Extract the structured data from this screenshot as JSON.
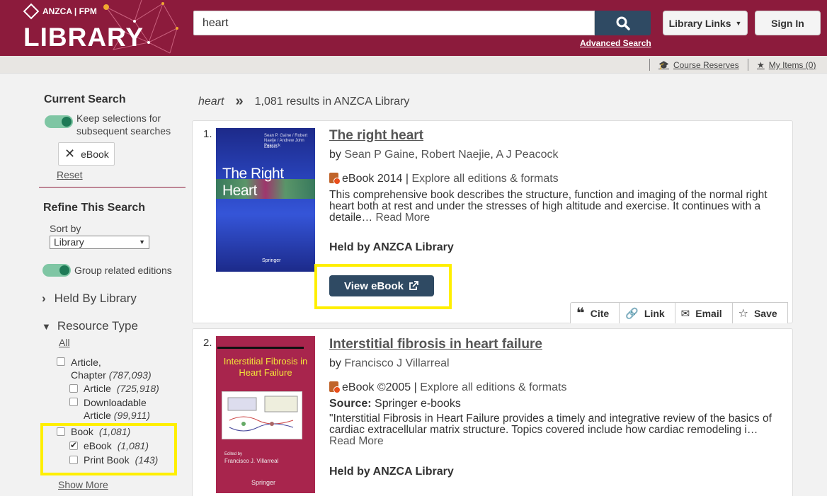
{
  "header": {
    "logo_org": "ANZCA | FPM",
    "logo_title": "LIBRARY",
    "search_value": "heart",
    "advanced_search": "Advanced Search",
    "library_links": "Library Links",
    "sign_in": "Sign In"
  },
  "subbar": {
    "course_reserves": "Course Reserves",
    "my_items": "My Items (0)"
  },
  "sidebar": {
    "current_search": "Current Search",
    "keep_selections": "Keep selections for subsequent searches",
    "chip_label": "eBook",
    "reset": "Reset",
    "refine": "Refine This Search",
    "sort_by_label": "Sort by",
    "sort_value": "Library",
    "group_editions": "Group related editions",
    "held_by": "Held By Library",
    "resource_type": "Resource Type",
    "all": "All",
    "facets": [
      {
        "label1": "Article,",
        "label2": "Chapter",
        "count": "(787,093)",
        "checked": false
      },
      {
        "label": "Article",
        "count": "(725,918)",
        "checked": false
      },
      {
        "label1": "Downloadable",
        "label2": "Article",
        "count": "(99,911)",
        "checked": false
      },
      {
        "label": "Book",
        "count": "(1,081)",
        "checked": false
      },
      {
        "label": "eBook",
        "count": "(1,081)",
        "checked": true
      },
      {
        "label": "Print Book",
        "count": "(143)",
        "checked": false
      }
    ],
    "show_more": "Show More"
  },
  "results_header": {
    "query": "heart",
    "summary": "1,081 results in ANZCA Library"
  },
  "results": [
    {
      "num": "1.",
      "title": "The right heart",
      "by": "by",
      "authors": [
        "Sean P Gaine",
        "Robert Naejie",
        "A J Peacock"
      ],
      "format": "eBook 2014",
      "explore": "Explore all editions & formats",
      "description": "This comprehensive book describes the structure, function and imaging of the normal right heart both at rest and under the stresses of high altitude and exercise. It continues with a detaile…",
      "read_more": "Read More",
      "held": "Held by ANZCA Library",
      "view_btn": "View eBook",
      "cover_title": "The Right Heart",
      "cover_authors": "Sean P. Gaine / Robert Naeije / Andrew John Peacock",
      "cover_editors": "Editors",
      "cover_publisher": "Springer",
      "actions": [
        "Cite",
        "Link",
        "Email",
        "Save"
      ]
    },
    {
      "num": "2.",
      "title": "Interstitial fibrosis in heart failure",
      "by": "by",
      "authors": [
        "Francisco J Villarreal"
      ],
      "format": "eBook ©2005",
      "explore": "Explore all editions & formats",
      "source_label": "Source:",
      "source_value": "Springer e-books",
      "description": "\"Interstitial Fibrosis in Heart Failure provides a timely and integrative review of the basics of cardiac extracellular matrix structure. Topics covered include how cardiac remodeling i…",
      "read_more": "Read More",
      "held": "Held by ANZCA Library",
      "cover_title": "Interstitial Fibrosis in Heart Failure",
      "cover_editor_label": "Edited by",
      "cover_editor": "Francisco J. Villarreal",
      "cover_publisher": "Springer"
    }
  ],
  "colors": {
    "brand": "#8c1b3c",
    "button": "#2f4a63",
    "toggle": "#1e7a56",
    "highlight": "#ffef00"
  }
}
